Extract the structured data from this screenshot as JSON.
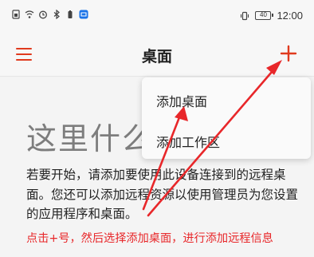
{
  "status_bar": {
    "time": "12:00",
    "battery": "40",
    "left_icons": [
      "sim-icon",
      "wifi-icon",
      "alarm-icon",
      "bluetooth-icon",
      "battery-saver-icon",
      "app-notification-icon"
    ],
    "right_icons": [
      "vibrate-icon",
      "battery-icon"
    ]
  },
  "app_bar": {
    "title": "桌面",
    "menu_icon": "hamburger-menu-icon",
    "add_icon": "plus-icon"
  },
  "dropdown": {
    "items": [
      {
        "label": "添加桌面"
      },
      {
        "label": "添加工作区"
      }
    ]
  },
  "content": {
    "hero": "这里什么",
    "description": "若要开始，请添加要使用此设备连接到的远程桌面。您还可以添加远程资源以使用管理员为您设置的应用程序和桌面。"
  },
  "annotation": {
    "text": "点击+号，然后选择添加桌面，进行添加远程信息"
  },
  "colors": {
    "accent": "#e03a1e",
    "annotation": "#e8272a",
    "hero_text": "#7d7d7d"
  }
}
